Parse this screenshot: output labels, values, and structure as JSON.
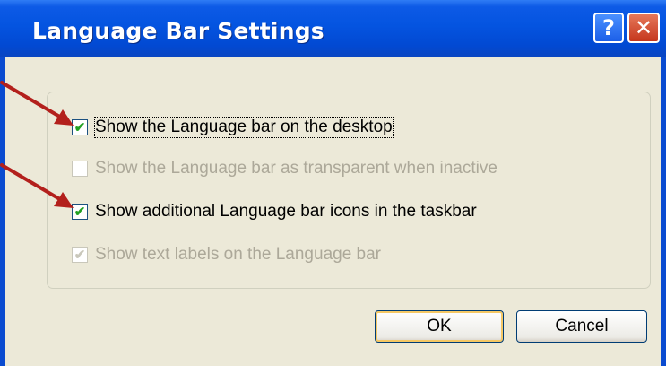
{
  "window": {
    "title": "Language Bar Settings",
    "help_label": "?",
    "close_label": "✕"
  },
  "options": [
    {
      "label": "Show the Language bar on the desktop",
      "checked": true,
      "enabled": true
    },
    {
      "label": "Show the Language bar as transparent when inactive",
      "checked": false,
      "enabled": false
    },
    {
      "label": "Show additional Language bar icons in the taskbar",
      "checked": true,
      "enabled": true
    },
    {
      "label": "Show text labels on the Language bar",
      "checked": true,
      "enabled": false
    }
  ],
  "buttons": {
    "ok": "OK",
    "cancel": "Cancel"
  },
  "colors": {
    "title_bar": "#0454e0",
    "annotation_arrow": "#b3201c",
    "dialog_background": "#ece9d8"
  }
}
